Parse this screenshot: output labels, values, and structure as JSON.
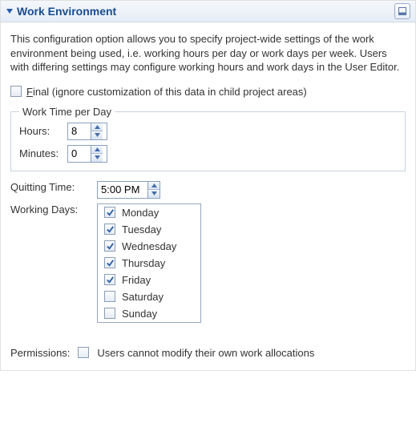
{
  "header": {
    "title": "Work Environment"
  },
  "description": "This configuration option allows you to specify project-wide settings of the work environment being used, i.e. working hours per day or work days per week. Users with differing settings may configure working hours and work days in the User Editor.",
  "finalCheckbox": {
    "hotkey": "F",
    "rest": "inal (ignore customization of this data in child project areas)",
    "checked": false
  },
  "workTime": {
    "legend": "Work Time per Day",
    "hoursLabel": "Hours:",
    "hoursValue": "8",
    "minutesLabel": "Minutes:",
    "minutesValue": "0"
  },
  "quittingTime": {
    "label": "Quitting Time:",
    "value": "5:00 PM"
  },
  "workingDays": {
    "label": "Working Days:",
    "days": [
      {
        "name": "Monday",
        "checked": true
      },
      {
        "name": "Tuesday",
        "checked": true
      },
      {
        "name": "Wednesday",
        "checked": true
      },
      {
        "name": "Thursday",
        "checked": true
      },
      {
        "name": "Friday",
        "checked": true
      },
      {
        "name": "Saturday",
        "checked": false
      },
      {
        "name": "Sunday",
        "checked": false
      }
    ]
  },
  "permissions": {
    "label": "Permissions:",
    "option": "Users cannot modify their own work allocations",
    "checked": false
  }
}
